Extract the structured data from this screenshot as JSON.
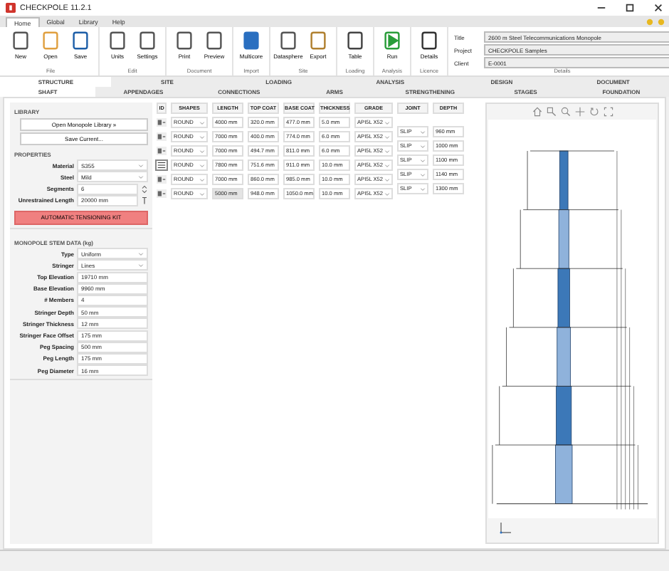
{
  "window": {
    "title": "CHECKPOLE 11.2.1"
  },
  "menu_tabs": [
    {
      "label": "Home",
      "selected": true
    },
    {
      "label": "Global",
      "selected": false
    },
    {
      "label": "Library",
      "selected": false
    },
    {
      "label": "Help",
      "selected": false
    }
  ],
  "ribbon_groups": [
    {
      "label": "File",
      "buttons": [
        "New",
        "Open",
        "Save"
      ]
    },
    {
      "label": "Edit",
      "buttons": [
        "Units",
        "Settings"
      ]
    },
    {
      "label": "Document",
      "buttons": [
        "Print",
        "Preview"
      ]
    },
    {
      "label": "Import",
      "buttons": [
        "Multicore"
      ]
    },
    {
      "label": "Site",
      "buttons": [
        "Datasphere",
        "Export"
      ]
    },
    {
      "label": "Loading",
      "buttons": [
        "Table"
      ]
    },
    {
      "label": "Analysis",
      "buttons": [
        "Run"
      ]
    },
    {
      "label": "Licence",
      "buttons": [
        "Details"
      ]
    }
  ],
  "details": {
    "label": "Details",
    "fields": [
      {
        "label": "Title",
        "value": "2600 m Steel Telecommunications Monopole"
      },
      {
        "label": "Project",
        "value": "CHECKPOLE Samples"
      },
      {
        "label": "Client",
        "value": "E-0001"
      }
    ]
  },
  "main_tabs": [
    {
      "label": "STRUCTURE",
      "selected": true
    },
    {
      "label": "SITE",
      "selected": false
    },
    {
      "label": "LOADING",
      "selected": false
    },
    {
      "label": "ANALYSIS",
      "selected": false
    },
    {
      "label": "DESIGN",
      "selected": false
    },
    {
      "label": "DOCUMENT",
      "selected": false
    }
  ],
  "sub_tabs": [
    {
      "label": "SHAFT",
      "selected": true
    },
    {
      "label": "APPENDAGES",
      "selected": false
    },
    {
      "label": "CONNECTIONS",
      "selected": false
    },
    {
      "label": "ARMS",
      "selected": false
    },
    {
      "label": "STRENGTHENING",
      "selected": false
    },
    {
      "label": "STAGES",
      "selected": false
    },
    {
      "label": "FOUNDATION",
      "selected": false
    }
  ],
  "library": {
    "heading": "LIBRARY",
    "buttons": [
      "Open Monopole Library »",
      "Save Current..."
    ]
  },
  "properties": {
    "heading": "PROPERTIES",
    "fields": [
      {
        "label": "Material",
        "value": "S355",
        "kind": "select"
      },
      {
        "label": "Steel",
        "value": "Mild",
        "kind": "select"
      },
      {
        "label": "Segments",
        "value": "6",
        "kind": "spin"
      },
      {
        "label": "Unrestrained Length",
        "value": "20000 mm",
        "kind": "pick"
      }
    ]
  },
  "action_button": "AUTOMATIC TENSIONING KIT",
  "stem": {
    "heading": "MONOPOLE STEM DATA (kg)",
    "fields": [
      {
        "label": "Type",
        "value": "Uniform",
        "kind": "select"
      },
      {
        "label": "Stringer",
        "value": "Lines",
        "kind": "select"
      },
      {
        "label": "Top Elevation",
        "value": "19710 mm",
        "kind": "input"
      },
      {
        "label": "Base Elevation",
        "value": "9960 mm",
        "kind": "input"
      },
      {
        "label": "# Members",
        "value": "4",
        "kind": "input"
      },
      {
        "label": "Stringer Depth",
        "value": "50 mm",
        "kind": "input"
      },
      {
        "label": "Stringer Thickness",
        "value": "12 mm",
        "kind": "input"
      },
      {
        "label": "Stringer Face Offset",
        "value": "175 mm",
        "kind": "input"
      },
      {
        "label": "Peg Spacing",
        "value": "500 mm",
        "kind": "input"
      },
      {
        "label": "Peg Length",
        "value": "175 mm",
        "kind": "input"
      },
      {
        "label": "Peg Diameter",
        "value": "16 mm",
        "kind": "input"
      }
    ]
  },
  "table": {
    "columns": [
      "ID",
      "SHAPES",
      "LENGTH",
      "TOP COAT",
      "BASE COAT",
      "THICKNESS",
      "GRADE",
      "JOINT",
      "DEPTH"
    ],
    "rows": [
      {
        "selected": false,
        "shape": "ROUND",
        "length": "4000 mm",
        "length_disabled": false,
        "top": "320.0 mm",
        "base": "477.0 mm",
        "thickness": "5.0 mm",
        "grade": "API5L X52"
      },
      {
        "selected": false,
        "shape": "ROUND",
        "length": "7000 mm",
        "length_disabled": false,
        "top": "400.0 mm",
        "base": "774.0 mm",
        "thickness": "6.0 mm",
        "grade": "API5L X52"
      },
      {
        "selected": false,
        "shape": "ROUND",
        "length": "7000 mm",
        "length_disabled": false,
        "top": "494.7 mm",
        "base": "811.0 mm",
        "thickness": "6.0 mm",
        "grade": "API5L X52"
      },
      {
        "selected": true,
        "shape": "ROUND",
        "length": "7800 mm",
        "length_disabled": false,
        "top": "751.6 mm",
        "base": "911.0 mm",
        "thickness": "10.0 mm",
        "grade": "API5L X52"
      },
      {
        "selected": false,
        "shape": "ROUND",
        "length": "7000 mm",
        "length_disabled": false,
        "top": "860.0 mm",
        "base": "985.0 mm",
        "thickness": "10.0 mm",
        "grade": "API5L X52"
      },
      {
        "selected": false,
        "shape": "ROUND",
        "length": "5000 mm",
        "length_disabled": true,
        "top": "948.0 mm",
        "base": "1050.0 mm",
        "thickness": "10.0 mm",
        "grade": "API5L X52"
      }
    ],
    "joints": [
      {
        "joint": "SLIP",
        "depth": "960 mm"
      },
      {
        "joint": "SLIP",
        "depth": "1000 mm"
      },
      {
        "joint": "SLIP",
        "depth": "1100 mm"
      },
      {
        "joint": "SLIP",
        "depth": "1140 mm"
      },
      {
        "joint": "SLIP",
        "depth": "1300 mm"
      }
    ]
  }
}
